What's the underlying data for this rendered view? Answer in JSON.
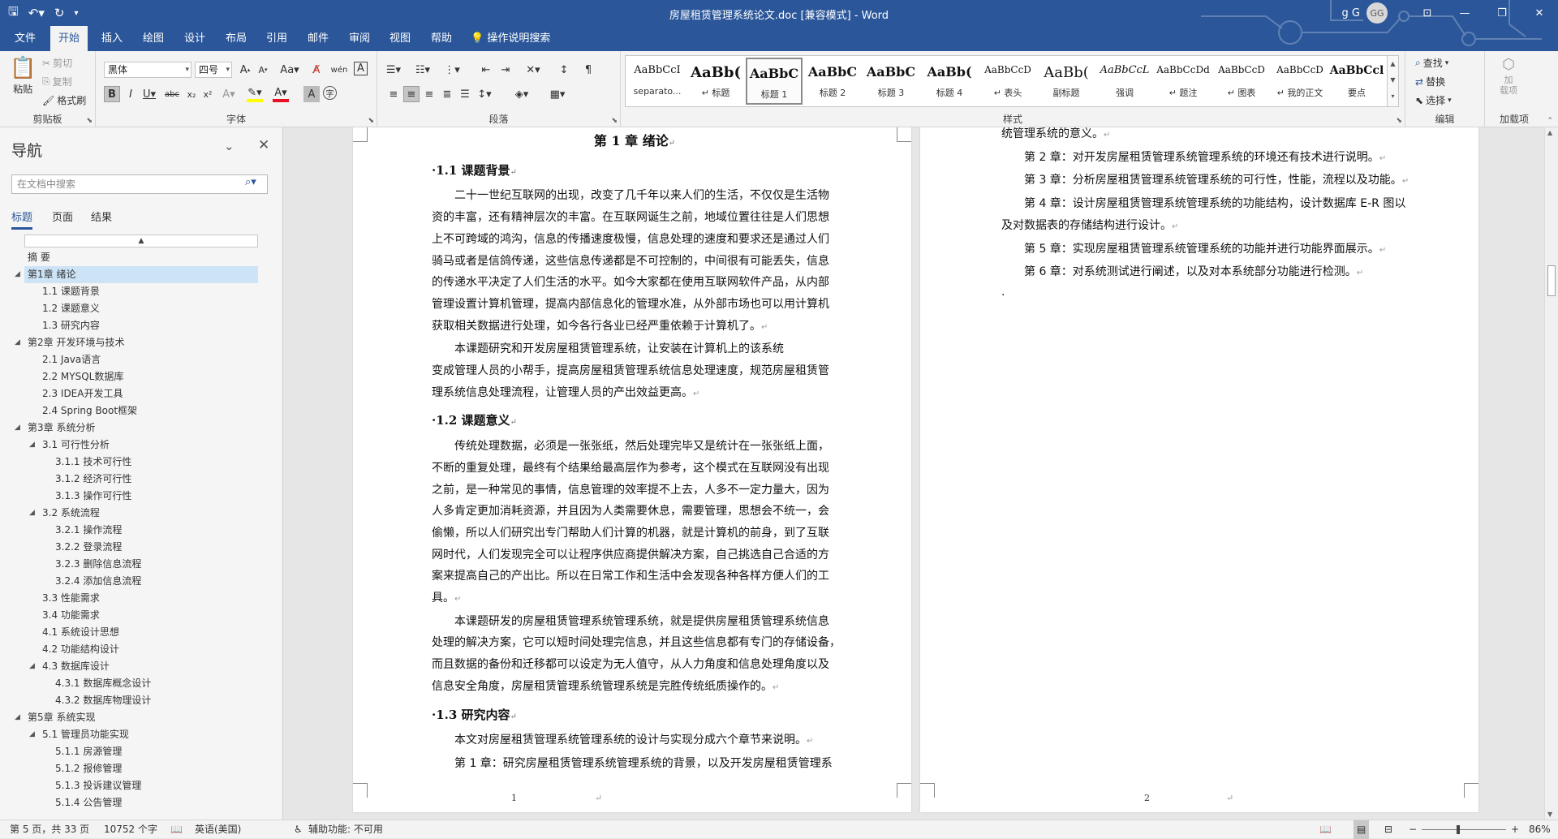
{
  "titlebar": {
    "document_title": "房屋租赁管理系统论文.doc [兼容模式] - Word",
    "user_name": "g G",
    "avatar_initials": "GG"
  },
  "tabs": [
    {
      "label": "文件"
    },
    {
      "label": "开始"
    },
    {
      "label": "插入"
    },
    {
      "label": "绘图"
    },
    {
      "label": "设计"
    },
    {
      "label": "布局"
    },
    {
      "label": "引用"
    },
    {
      "label": "邮件"
    },
    {
      "label": "审阅"
    },
    {
      "label": "视图"
    },
    {
      "label": "帮助"
    }
  ],
  "tell_me": "操作说明搜索",
  "ribbon": {
    "clipboard": {
      "paste": "粘贴",
      "cut": "剪切",
      "copy": "复制",
      "format_painter": "格式刷",
      "label": "剪贴板"
    },
    "font": {
      "font_name": "黑体",
      "font_size": "四号",
      "label": "字体"
    },
    "paragraph": {
      "label": "段落"
    },
    "styles": {
      "label": "样式",
      "items": [
        {
          "sample": "AaBbCcI",
          "name": "separato..."
        },
        {
          "sample": "AaBb(",
          "name": "↵ 标题"
        },
        {
          "sample": "AaBbC",
          "name": "标题 1"
        },
        {
          "sample": "AaBbC",
          "name": "标题 2"
        },
        {
          "sample": "AaBbC",
          "name": "标题 3"
        },
        {
          "sample": "AaBb(",
          "name": "标题 4"
        },
        {
          "sample": "AaBbCcD",
          "name": "↵ 表头"
        },
        {
          "sample": "AaBb(",
          "name": "副标题"
        },
        {
          "sample": "AaBbCcL",
          "name": "强调"
        },
        {
          "sample": "AaBbCcDd",
          "name": "↵ 题注"
        },
        {
          "sample": "AaBbCcD",
          "name": "↵ 图表"
        },
        {
          "sample": "AaBbCcD",
          "name": "↵ 我的正文"
        },
        {
          "sample": "AaBbCcl",
          "name": "要点"
        }
      ]
    },
    "editing": {
      "find": "查找",
      "replace": "替换",
      "select": "选择",
      "label": "编辑"
    },
    "addins": {
      "load": "加\n载项",
      "label": "加载项"
    }
  },
  "nav": {
    "title": "导航",
    "search_placeholder": "在文档中搜索",
    "tabs": [
      "标题",
      "页面",
      "结果"
    ],
    "items": [
      {
        "level": 1,
        "label": "摘  要",
        "has_toggle": false,
        "selected": false
      },
      {
        "level": 1,
        "label": "第1章 绪论",
        "has_toggle": true,
        "selected": true
      },
      {
        "level": 2,
        "label": "1.1 课题背景",
        "has_toggle": false,
        "selected": false
      },
      {
        "level": 2,
        "label": "1.2 课题意义",
        "has_toggle": false,
        "selected": false
      },
      {
        "level": 2,
        "label": "1.3 研究内容",
        "has_toggle": false,
        "selected": false
      },
      {
        "level": 1,
        "label": "第2章 开发环境与技术",
        "has_toggle": true,
        "selected": false
      },
      {
        "level": 2,
        "label": "2.1 Java语言",
        "has_toggle": false,
        "selected": false
      },
      {
        "level": 2,
        "label": "2.2 MYSQL数据库",
        "has_toggle": false,
        "selected": false
      },
      {
        "level": 2,
        "label": "2.3 IDEA开发工具",
        "has_toggle": false,
        "selected": false
      },
      {
        "level": 2,
        "label": "2.4 Spring Boot框架",
        "has_toggle": false,
        "selected": false
      },
      {
        "level": 1,
        "label": "第3章 系统分析",
        "has_toggle": true,
        "selected": false
      },
      {
        "level": 2,
        "label": "3.1 可行性分析",
        "has_toggle": true,
        "selected": false
      },
      {
        "level": 3,
        "label": "3.1.1 技术可行性",
        "has_toggle": false,
        "selected": false
      },
      {
        "level": 3,
        "label": "3.1.2 经济可行性",
        "has_toggle": false,
        "selected": false
      },
      {
        "level": 3,
        "label": "3.1.3 操作可行性",
        "has_toggle": false,
        "selected": false
      },
      {
        "level": 2,
        "label": "3.2 系统流程",
        "has_toggle": true,
        "selected": false
      },
      {
        "level": 3,
        "label": "3.2.1 操作流程",
        "has_toggle": false,
        "selected": false
      },
      {
        "level": 3,
        "label": "3.2.2 登录流程",
        "has_toggle": false,
        "selected": false
      },
      {
        "level": 3,
        "label": "3.2.3 删除信息流程",
        "has_toggle": false,
        "selected": false
      },
      {
        "level": 3,
        "label": "3.2.4 添加信息流程",
        "has_toggle": false,
        "selected": false
      },
      {
        "level": 2,
        "label": "3.3 性能需求",
        "has_toggle": false,
        "selected": false
      },
      {
        "level": 2,
        "label": "3.4 功能需求",
        "has_toggle": false,
        "selected": false
      },
      {
        "level": 2,
        "label": "4.1 系统设计思想",
        "has_toggle": false,
        "selected": false
      },
      {
        "level": 2,
        "label": "4.2 功能结构设计",
        "has_toggle": false,
        "selected": false
      },
      {
        "level": 2,
        "label": "4.3 数据库设计",
        "has_toggle": true,
        "selected": false
      },
      {
        "level": 3,
        "label": "4.3.1 数据库概念设计",
        "has_toggle": false,
        "selected": false
      },
      {
        "level": 3,
        "label": "4.3.2 数据库物理设计",
        "has_toggle": false,
        "selected": false
      },
      {
        "level": 1,
        "label": "第5章 系统实现",
        "has_toggle": true,
        "selected": false
      },
      {
        "level": 2,
        "label": "5.1 管理员功能实现",
        "has_toggle": true,
        "selected": false
      },
      {
        "level": 3,
        "label": "5.1.1 房源管理",
        "has_toggle": false,
        "selected": false
      },
      {
        "level": 3,
        "label": "5.1.2 报修管理",
        "has_toggle": false,
        "selected": false
      },
      {
        "level": 3,
        "label": "5.1.3 投诉建议管理",
        "has_toggle": false,
        "selected": false
      },
      {
        "level": 3,
        "label": "5.1.4 公告管理",
        "has_toggle": false,
        "selected": false
      }
    ]
  },
  "page1": {
    "chapter": "第 1 章  绪论",
    "h11": "1.1  课题背景",
    "p1": [
      "二十一世纪互联网的出现，改变了几千年以来人们的生活，不仅仅是生活物",
      "资的丰富，还有精神层次的丰富。在互联网诞生之前，地域位置往往是人们思想",
      "上不可跨域的鸿沟，信息的传播速度极慢，信息处理的速度和要求还是通过人们",
      "骑马或者是信鸽传递，这些信息传递都是不可控制的，中间很有可能丢失，信息",
      "的传递水平决定了人们生活的水平。如今大家都在使用互联网软件产品，从内部",
      "管理设置计算机管理，提高内部信息化的管理水准，从外部市场也可以用计算机",
      "获取相关数据进行处理，如今各行各业已经严重依赖于计算机了。"
    ],
    "p2": [
      "本课题研究和开发房屋租赁管理系统，让安装在计算机上的该系统",
      "变成管理人员的小帮手，提高房屋租赁管理系统信息处理速度，规范房屋租赁管",
      "理系统信息处理流程，让管理人员的产出效益更高。"
    ],
    "h12": "1.2  课题意义",
    "p3": [
      "传统处理数据，必须是一张张纸，然后处理完毕又是统计在一张张纸上面，",
      "不断的重复处理，最终有个结果给最高层作为参考，这个模式在互联网没有出现",
      "之前，是一种常见的事情，信息管理的效率提不上去，人多不一定力量大，因为",
      "人多肯定更加消耗资源，并且因为人类需要休息，需要管理，思想会不统一，会",
      "偷懒，所以人们研究出专门帮助人们计算的机器，就是计算机的前身，到了互联",
      "网时代，人们发现完全可以让程序供应商提供解决方案，自己挑选自己合适的方",
      "案来提高自己的产出比。所以在日常工作和生活中会发现各种各样方便人们的工",
      "具。"
    ],
    "p4": [
      "本课题研发的房屋租赁管理系统管理系统，就是提供房屋租赁管理系统信息",
      "处理的解决方案，它可以短时间处理完信息，并且这些信息都有专门的存储设备，",
      "而且数据的备份和迁移都可以设定为无人值守，从人力角度和信息处理角度以及",
      "信息安全角度，房屋租赁管理系统管理系统是完胜传统纸质操作的。"
    ],
    "h13": "1.3  研究内容",
    "p5": "本文对房屋租赁管理系统管理系统的设计与实现分成六个章节来说明。",
    "p6": "第 1 章：研究房屋租赁管理系统管理系统的背景，以及开发房屋租赁管理系",
    "page_number": "1"
  },
  "page2": {
    "l0": "统管理系统的意义。",
    "l1": "第 2 章：对开发房屋租赁管理系统管理系统的环境还有技术进行说明。",
    "l2": "第 3 章：分析房屋租赁管理系统管理系统的可行性，性能，流程以及功能。",
    "l3a": "第 4 章：设计房屋租赁管理系统管理系统的功能结构，设计数据库 E-R 图以",
    "l3b": "及对数据表的存储结构进行设计。",
    "l4": "第 5 章：实现房屋租赁管理系统管理系统的功能并进行功能界面展示。",
    "l5": "第 6 章：对系统测试进行阐述，以及对本系统部分功能进行检测。",
    "page_number": "2"
  },
  "status": {
    "page": "第 5 页，共 33 页",
    "words": "10752 个字",
    "language": "英语(美国)",
    "accessibility": "辅助功能: 不可用",
    "zoom": "86%",
    "zoom_level": 0.43
  },
  "colors": {
    "accent": "#2b579a",
    "nav_selected": "#cde4f7",
    "squiggle": "#e81123"
  }
}
